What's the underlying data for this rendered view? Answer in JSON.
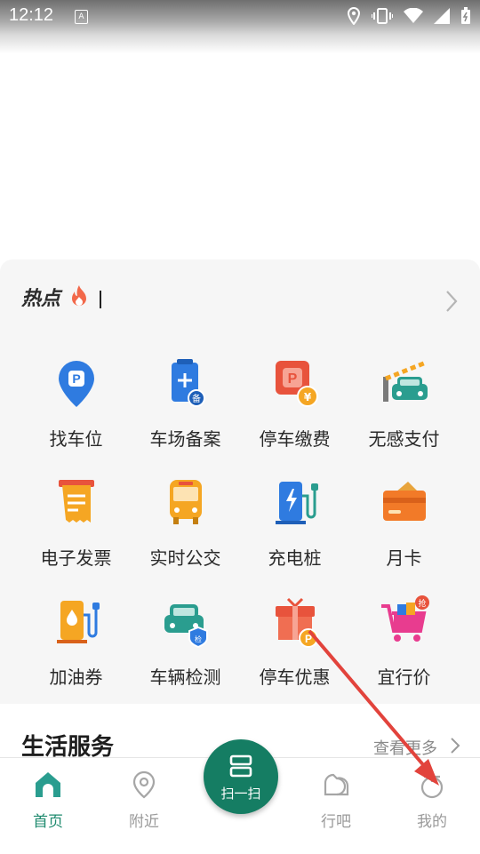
{
  "status_bar": {
    "time": "12:12",
    "sim_badge": "A"
  },
  "hot_section": {
    "title": "热点"
  },
  "grid": [
    {
      "label": "找车位",
      "icon": "parking-location-icon"
    },
    {
      "label": "车场备案",
      "icon": "clipboard-record-icon"
    },
    {
      "label": "停车缴费",
      "icon": "parking-payment-icon"
    },
    {
      "label": "无感支付",
      "icon": "barrier-car-icon"
    },
    {
      "label": "电子发票",
      "icon": "invoice-icon"
    },
    {
      "label": "实时公交",
      "icon": "bus-icon"
    },
    {
      "label": "充电桩",
      "icon": "charging-station-icon"
    },
    {
      "label": "月卡",
      "icon": "monthly-card-icon"
    },
    {
      "label": "加油券",
      "icon": "fuel-coupon-icon"
    },
    {
      "label": "车辆检测",
      "icon": "vehicle-inspection-icon"
    },
    {
      "label": "停车优惠",
      "icon": "parking-gift-icon"
    },
    {
      "label": "宜行价",
      "icon": "shopping-cart-icon"
    }
  ],
  "life_services": {
    "title": "生活服务",
    "more_label": "查看更多"
  },
  "tabbar": {
    "home": "首页",
    "nearby": "附近",
    "scan": "扫一扫",
    "go": "行吧",
    "mine": "我的"
  },
  "colors": {
    "accent": "#157d63",
    "active_tab": "#1e8a6e",
    "annotation_arrow": "#e2433c"
  }
}
